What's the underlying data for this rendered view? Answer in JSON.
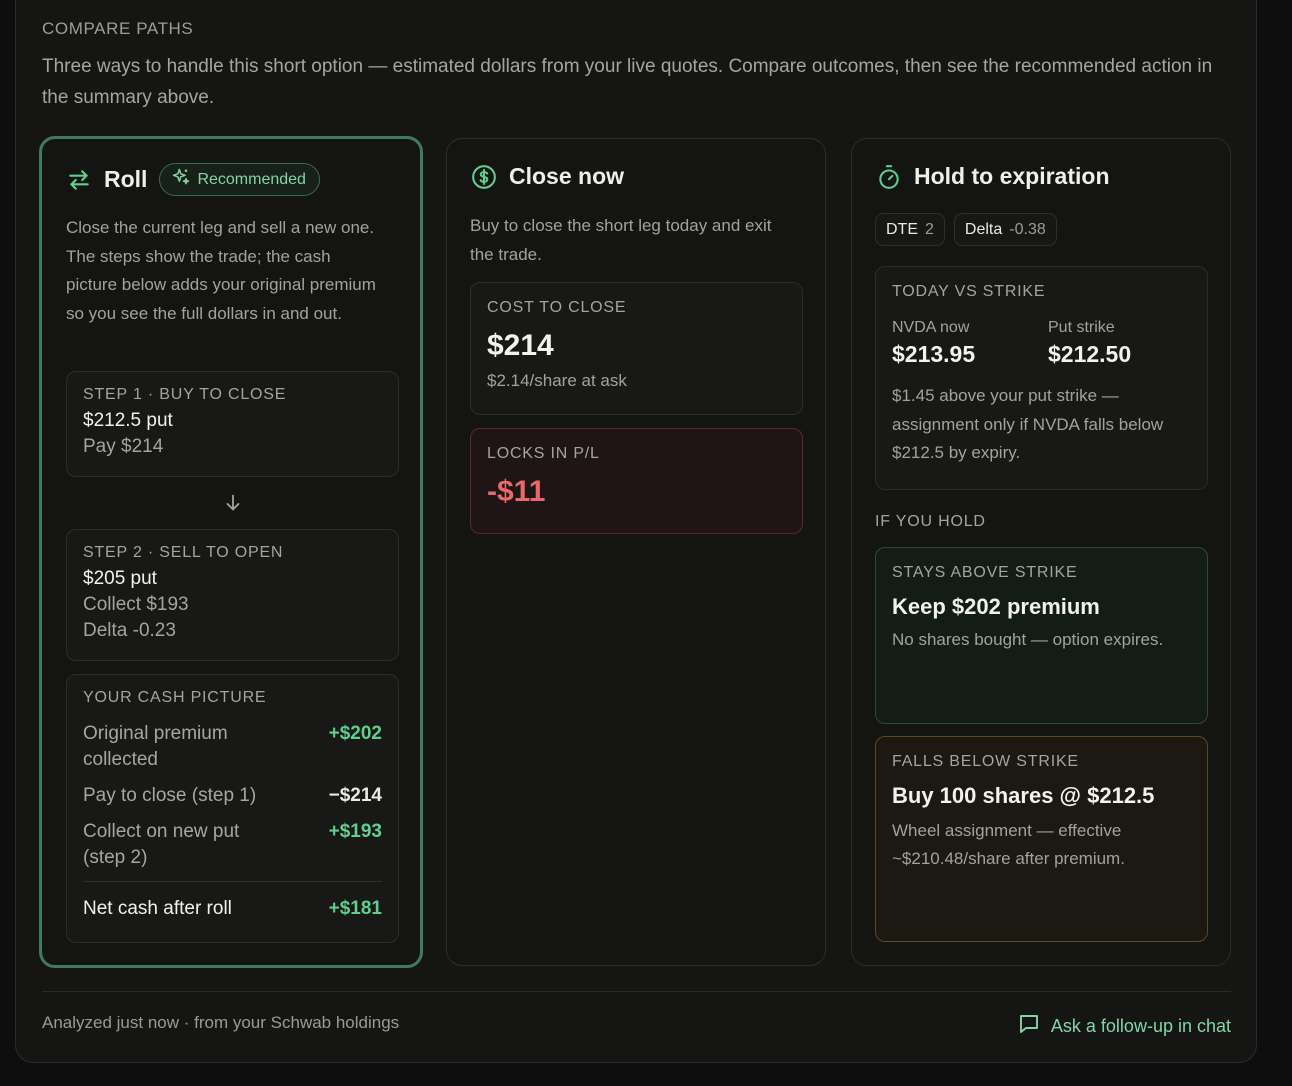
{
  "section_label": "COMPARE PATHS",
  "intro": "Three ways to handle this short option — estimated dollars from your live quotes. Compare outcomes, then see the recommended action in the summary above.",
  "roll": {
    "title": "Roll",
    "badge": "Recommended",
    "description": "Close the current leg and sell a new one. The steps show the trade; the cash picture below adds your original premium so you see the full dollars in and out.",
    "step1": {
      "label": "STEP 1 · BUY TO CLOSE",
      "title": "$212.5 put",
      "sub": "Pay $214"
    },
    "step2": {
      "label": "STEP 2 · SELL TO OPEN",
      "title": "$205 put",
      "sub1": "Collect $193",
      "sub2": "Delta -0.23"
    },
    "cash": {
      "label": "YOUR CASH PICTURE",
      "rows": [
        {
          "label": "Original premium collected",
          "value": "+$202"
        },
        {
          "label": "Pay to close (step 1)",
          "value": "−$214"
        },
        {
          "label": "Collect on new put (step 2)",
          "value": "+$193"
        }
      ],
      "net_label": "Net cash after roll",
      "net_value": "+$181"
    }
  },
  "close": {
    "title": "Close now",
    "description": "Buy to close the short leg today and exit the trade.",
    "cost_label": "COST TO CLOSE",
    "cost_value": "$214",
    "cost_sub": "$2.14/share at ask",
    "locks_label": "LOCKS IN P/L",
    "locks_value": "-$11"
  },
  "hold": {
    "title": "Hold to expiration",
    "chips": [
      {
        "key": "DTE",
        "value": "2"
      },
      {
        "key": "Delta",
        "value": "-0.38"
      }
    ],
    "today_label": "TODAY VS STRIKE",
    "now_label": "NVDA now",
    "now_value": "$213.95",
    "strike_label": "Put strike",
    "strike_value": "$212.50",
    "today_note": "$1.45 above your put strike — assignment only if NVDA falls below $212.5 by expiry.",
    "if_hold_label": "IF YOU HOLD",
    "above": {
      "label": "STAYS ABOVE STRIKE",
      "title": "Keep $202 premium",
      "sub": "No shares bought — option expires."
    },
    "below": {
      "label": "FALLS BELOW STRIKE",
      "title": "Buy 100 shares @ $212.5",
      "sub": "Wheel assignment — effective ~$210.48/share after premium."
    }
  },
  "footer": {
    "left": "Analyzed just now · from your Schwab holdings",
    "right": "Ask a follow-up in chat"
  },
  "colors": {
    "accent_green": "#5fcf8c",
    "loss_red": "#e8696a",
    "roll_border": "#3f7c5c"
  }
}
